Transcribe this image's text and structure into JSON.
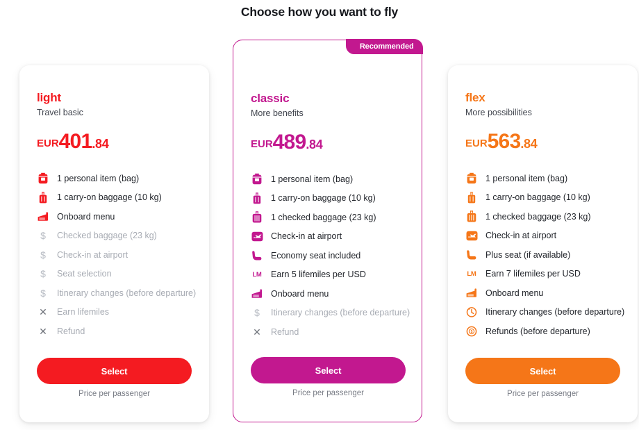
{
  "header": {
    "title": "Choose how you want to fly"
  },
  "colors": {
    "light": "#f41b21",
    "classic": "#c2188f",
    "flex": "#f57618",
    "muted": "#a7abb3",
    "text": "#23262c"
  },
  "cards": [
    {
      "id": "light",
      "name": "light",
      "subtitle": "Travel basic",
      "currency": "EUR",
      "price_whole": "401",
      "price_decimal": ".84",
      "accent": "#f41b21",
      "recommended": false,
      "badge_label": "",
      "select_label": "Select",
      "footnote": "Price per passenger",
      "features": [
        {
          "icon": "backpack-icon",
          "label": "1 personal item (bag)",
          "included": true
        },
        {
          "icon": "carryon-icon",
          "label": "1 carry-on baggage (10 kg)",
          "included": true
        },
        {
          "icon": "onboard-menu-icon",
          "label": "Onboard menu",
          "included": true
        },
        {
          "icon": "dollar-icon",
          "label": "Checked baggage (23 kg)",
          "included": false
        },
        {
          "icon": "dollar-icon",
          "label": "Check-in at airport",
          "included": false
        },
        {
          "icon": "dollar-icon",
          "label": "Seat selection",
          "included": false
        },
        {
          "icon": "dollar-icon",
          "label": "Itinerary changes (before departure)",
          "included": false
        },
        {
          "icon": "cross-icon",
          "label": "Earn lifemiles",
          "included": false
        },
        {
          "icon": "cross-icon",
          "label": "Refund",
          "included": false
        }
      ]
    },
    {
      "id": "classic",
      "name": "classic",
      "subtitle": "More benefits",
      "currency": "EUR",
      "price_whole": "489",
      "price_decimal": ".84",
      "accent": "#c2188f",
      "recommended": true,
      "badge_label": "Recommended",
      "select_label": "Select",
      "footnote": "Price per passenger",
      "features": [
        {
          "icon": "backpack-icon",
          "label": "1 personal item (bag)",
          "included": true
        },
        {
          "icon": "carryon-icon",
          "label": "1 carry-on baggage (10 kg)",
          "included": true
        },
        {
          "icon": "checked-bag-icon",
          "label": "1 checked baggage (23 kg)",
          "included": true
        },
        {
          "icon": "checkin-plane-icon",
          "label": "Check-in at airport",
          "included": true
        },
        {
          "icon": "seat-icon",
          "label": "Economy seat included",
          "included": true
        },
        {
          "icon": "lifemiles-icon",
          "label": "Earn 5 lifemiles per USD",
          "included": true
        },
        {
          "icon": "onboard-menu-icon",
          "label": "Onboard menu",
          "included": true
        },
        {
          "icon": "dollar-icon",
          "label": "Itinerary changes (before departure)",
          "included": false
        },
        {
          "icon": "cross-icon",
          "label": "Refund",
          "included": false
        }
      ]
    },
    {
      "id": "flex",
      "name": "flex",
      "subtitle": "More possibilities",
      "currency": "EUR",
      "price_whole": "563",
      "price_decimal": ".84",
      "accent": "#f57618",
      "recommended": false,
      "badge_label": "",
      "select_label": "Select",
      "footnote": "Price per passenger",
      "features": [
        {
          "icon": "backpack-icon",
          "label": "1 personal item (bag)",
          "included": true
        },
        {
          "icon": "carryon-icon",
          "label": "1 carry-on baggage (10 kg)",
          "included": true
        },
        {
          "icon": "checked-bag-icon",
          "label": "1 checked baggage (23 kg)",
          "included": true
        },
        {
          "icon": "checkin-plane-icon",
          "label": "Check-in at airport",
          "included": true
        },
        {
          "icon": "seat-icon",
          "label": "Plus seat (if available)",
          "included": true
        },
        {
          "icon": "lifemiles-icon",
          "label": "Earn 7 lifemiles per USD",
          "included": true
        },
        {
          "icon": "onboard-menu-icon",
          "label": "Onboard menu",
          "included": true
        },
        {
          "icon": "clock-back-icon",
          "label": "Itinerary changes (before departure)",
          "included": true
        },
        {
          "icon": "refund-icon",
          "label": "Refunds (before departure)",
          "included": true
        }
      ]
    }
  ]
}
